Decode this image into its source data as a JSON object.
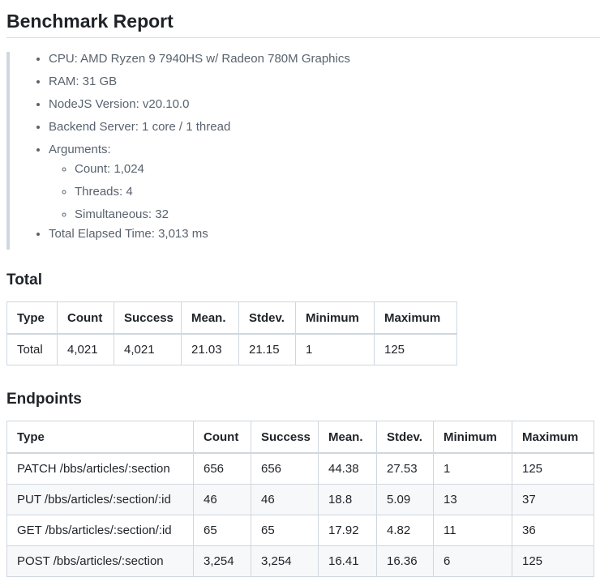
{
  "title": "Benchmark Report",
  "specs": {
    "cpu": "CPU: AMD Ryzen 9 7940HS w/ Radeon 780M Graphics",
    "ram": "RAM: 31 GB",
    "node": "NodeJS Version: v20.10.0",
    "backend": "Backend Server: 1 core / 1 thread",
    "arguments_label": "Arguments:",
    "arguments": {
      "count": "Count: 1,024",
      "threads": "Threads: 4",
      "simultaneous": "Simultaneous: 32"
    },
    "elapsed": "Total Elapsed Time: 3,013 ms"
  },
  "total": {
    "heading": "Total",
    "headers": [
      "Type",
      "Count",
      "Success",
      "Mean.",
      "Stdev.",
      "Minimum",
      "Maximum"
    ],
    "rows": [
      [
        "Total",
        "4,021",
        "4,021",
        "21.03",
        "21.15",
        "1",
        "125"
      ]
    ]
  },
  "endpoints": {
    "heading": "Endpoints",
    "headers": [
      "Type",
      "Count",
      "Success",
      "Mean.",
      "Stdev.",
      "Minimum",
      "Maximum"
    ],
    "rows": [
      [
        "PATCH /bbs/articles/:section",
        "656",
        "656",
        "44.38",
        "27.53",
        "1",
        "125"
      ],
      [
        "PUT /bbs/articles/:section/:id",
        "46",
        "46",
        "18.8",
        "5.09",
        "13",
        "37"
      ],
      [
        "GET /bbs/articles/:section/:id",
        "65",
        "65",
        "17.92",
        "4.82",
        "11",
        "36"
      ],
      [
        "POST /bbs/articles/:section",
        "3,254",
        "3,254",
        "16.41",
        "16.36",
        "6",
        "125"
      ]
    ]
  }
}
